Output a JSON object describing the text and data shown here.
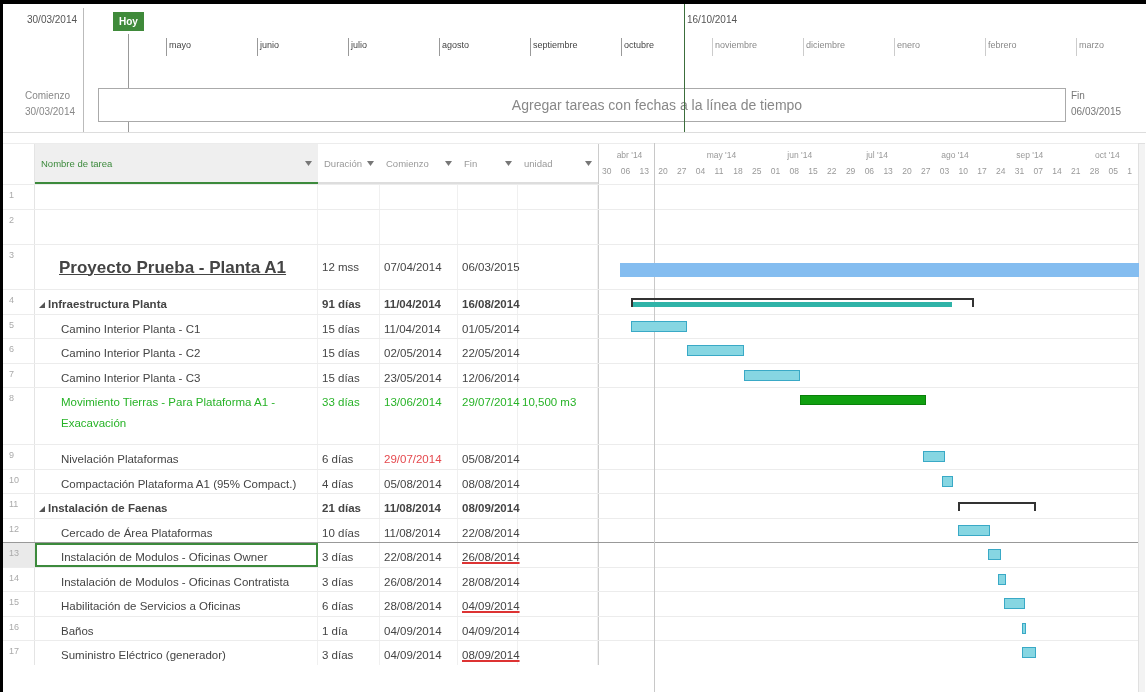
{
  "timeline": {
    "start_date": "30/03/2014",
    "today_label": "Hoy",
    "marker_date": "16/10/2014",
    "start_label": "Comienzo",
    "start_value": "30/03/2014",
    "finish_label": "Fin",
    "finish_value": "06/03/2015",
    "placeholder": "Agregar tareas con fechas a la línea de tiempo",
    "months": [
      {
        "label": "mayo",
        "in_view": true
      },
      {
        "label": "junio",
        "in_view": true
      },
      {
        "label": "julio",
        "in_view": true
      },
      {
        "label": "agosto",
        "in_view": true
      },
      {
        "label": "septiembre",
        "in_view": true
      },
      {
        "label": "octubre",
        "in_view": true
      },
      {
        "label": "noviembre",
        "in_view": false
      },
      {
        "label": "diciembre",
        "in_view": false
      },
      {
        "label": "enero",
        "in_view": false
      },
      {
        "label": "febrero",
        "in_view": false
      },
      {
        "label": "marzo",
        "in_view": false
      }
    ]
  },
  "table": {
    "columns": [
      {
        "label": "Nombre de tarea",
        "selected": true
      },
      {
        "label": "Duración",
        "selected": false
      },
      {
        "label": "Comienzo",
        "selected": false
      },
      {
        "label": "Fin",
        "selected": false
      },
      {
        "label": "unidad",
        "selected": false
      }
    ],
    "rows": [
      {
        "number": "1",
        "kind": "empty"
      },
      {
        "number": "2",
        "kind": "empty"
      },
      {
        "number": "3",
        "kind": "project",
        "name": "Proyecto Prueba - Planta A1",
        "duration": "12 mss",
        "start": "07/04/2014",
        "finish": "06/03/2015",
        "selected": false,
        "highlighted": false,
        "start_late": false,
        "finish_underlined": false
      },
      {
        "number": "4",
        "kind": "summary",
        "expanded": true,
        "level": 0.94,
        "name": "Infraestructura Planta",
        "duration": "91 días",
        "start": "11/04/2014",
        "finish": "16/08/2014",
        "selected": false,
        "highlighted": false,
        "start_late": false,
        "finish_underlined": false
      },
      {
        "number": "5",
        "kind": "task",
        "name": "Camino Interior Planta - C1",
        "duration": "15 días",
        "start": "11/04/2014",
        "finish": "01/05/2014",
        "selected": false,
        "highlighted": false,
        "start_late": false,
        "finish_underlined": false
      },
      {
        "number": "6",
        "kind": "task",
        "name": "Camino Interior Planta - C2",
        "duration": "15 días",
        "start": "02/05/2014",
        "finish": "22/05/2014",
        "selected": false,
        "highlighted": false,
        "start_late": false,
        "finish_underlined": false
      },
      {
        "number": "7",
        "kind": "task",
        "name": "Camino Interior Planta - C3",
        "duration": "15 días",
        "start": "23/05/2014",
        "finish": "12/06/2014",
        "selected": false,
        "highlighted": false,
        "start_late": false,
        "finish_underlined": false
      },
      {
        "number": "8",
        "kind": "task",
        "name": "Movimiento Tierras - Para Plataforma A1 - Exacavación",
        "duration": "33 días",
        "start": "13/06/2014",
        "finish": "29/07/2014",
        "unit": "10,500 m3",
        "selected": false,
        "highlighted": true,
        "start_late": false,
        "finish_underlined": false
      },
      {
        "number": "9",
        "kind": "task",
        "name": "Nivelación Plataformas",
        "duration": "6 días",
        "start": "29/07/2014",
        "finish": "05/08/2014",
        "selected": false,
        "highlighted": false,
        "start_late": true,
        "finish_underlined": false
      },
      {
        "number": "10",
        "kind": "task",
        "name": "Compactación Plataforma A1 (95% Compact.)",
        "duration": "4 días",
        "start": "05/08/2014",
        "finish": "08/08/2014",
        "selected": false,
        "highlighted": false,
        "start_late": false,
        "finish_underlined": false
      },
      {
        "number": "11",
        "kind": "summary",
        "expanded": true,
        "name": "Instalación de Faenas",
        "duration": "21 días",
        "start": "11/08/2014",
        "finish": "08/09/2014",
        "selected": false,
        "highlighted": false,
        "start_late": false,
        "finish_underlined": false
      },
      {
        "number": "12",
        "kind": "task",
        "name": "Cercado de Área Plataformas",
        "duration": "10 días",
        "start": "11/08/2014",
        "finish": "22/08/2014",
        "selected": false,
        "highlighted": false,
        "start_late": false,
        "finish_underlined": false
      },
      {
        "number": "13",
        "kind": "task",
        "name": "Instalación de Modulos - Oficinas Owner",
        "duration": "3 días",
        "start": "22/08/2014",
        "finish": "26/08/2014",
        "selected": true,
        "highlighted": false,
        "start_late": false,
        "finish_underlined": true
      },
      {
        "number": "14",
        "kind": "task",
        "name": "Instalación de Modulos - Oficinas Contratista",
        "duration": "3 días",
        "start": "26/08/2014",
        "finish": "28/08/2014",
        "selected": false,
        "highlighted": false,
        "start_late": false,
        "finish_underlined": false
      },
      {
        "number": "15",
        "kind": "task",
        "name": "Habilitación de Servicios a Oficinas",
        "duration": "6 días",
        "start": "28/08/2014",
        "finish": "04/09/2014",
        "selected": false,
        "highlighted": false,
        "start_late": false,
        "finish_underlined": true
      },
      {
        "number": "16",
        "kind": "task",
        "name": "Baños",
        "duration": "1 día",
        "start": "04/09/2014",
        "finish": "04/09/2014",
        "selected": false,
        "highlighted": false,
        "start_late": false,
        "finish_underlined": false
      },
      {
        "number": "17",
        "kind": "task",
        "name": "Suministro Eléctrico (generador)",
        "duration": "3 días",
        "start": "04/09/2014",
        "finish": "08/09/2014",
        "selected": false,
        "highlighted": false,
        "start_late": false,
        "finish_underlined": true
      }
    ]
  },
  "gantt": {
    "months": [
      "abr '14",
      "may '14",
      "jun '14",
      "jul '14",
      "ago '14",
      "sep '14",
      "oct '14"
    ],
    "weeks": [
      "30",
      "06",
      "13",
      "20",
      "27",
      "04",
      "11",
      "18",
      "25",
      "01",
      "08",
      "15",
      "22",
      "29",
      "06",
      "13",
      "20",
      "27",
      "03",
      "10",
      "17",
      "24",
      "31",
      "07",
      "14",
      "21",
      "28",
      "05",
      "1"
    ]
  }
}
